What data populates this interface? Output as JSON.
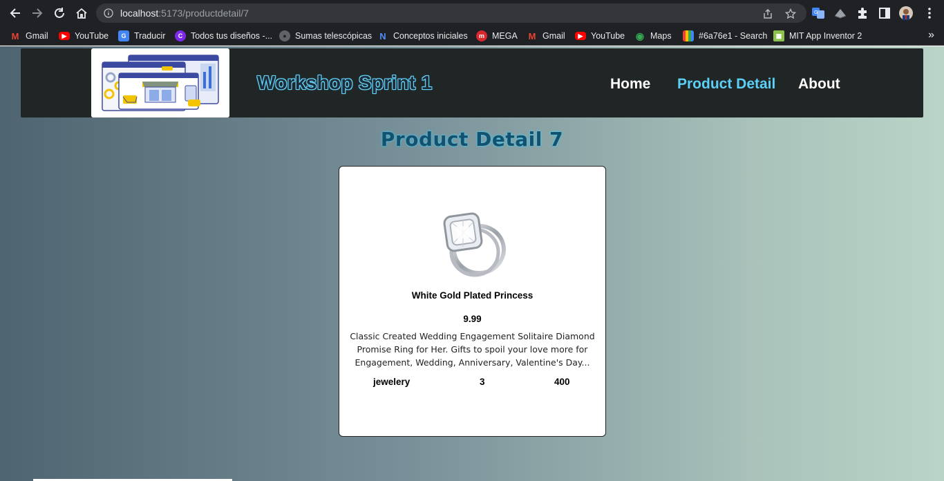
{
  "browser": {
    "url_host": "localhost",
    "url_rest": ":5173/productdetail/7",
    "icons": [
      "back-icon",
      "forward-icon",
      "reload-icon",
      "home-icon",
      "info-icon",
      "share-icon",
      "star-icon",
      "translate-icon",
      "extension-icon",
      "puzzle-icon",
      "sidepanel-icon",
      "profile-avatar",
      "more-icon"
    ]
  },
  "bookmarks": [
    {
      "label": "Gmail",
      "icon": "gmail-icon",
      "color": "#ea4335"
    },
    {
      "label": "YouTube",
      "icon": "youtube-icon",
      "color": "#ff0000"
    },
    {
      "label": "Traducir",
      "icon": "translate-icon",
      "color": "#4285f4"
    },
    {
      "label": "Todos tus diseños -...",
      "icon": "canva-icon",
      "color": "#7d2ae8"
    },
    {
      "label": "Sumas telescópicas",
      "icon": "globe-icon",
      "color": "#9aa0a6"
    },
    {
      "label": "Conceptos iniciales",
      "icon": "notion-icon",
      "color": "#2b6cd4"
    },
    {
      "label": "MEGA",
      "icon": "mega-icon",
      "color": "#d9272e"
    },
    {
      "label": "Gmail",
      "icon": "gmail-icon",
      "color": "#ea4335"
    },
    {
      "label": "YouTube",
      "icon": "youtube-icon",
      "color": "#ff0000"
    },
    {
      "label": "Maps",
      "icon": "maps-icon",
      "color": "#34a853"
    },
    {
      "label": "#6a76e1 - Search",
      "icon": "colorbar-icon",
      "color": "#f4b400"
    },
    {
      "label": "MIT App Inventor 2",
      "icon": "appinventor-icon",
      "color": "#8bc34a"
    }
  ],
  "header": {
    "brand": "Workshop Sprint 1",
    "nav": [
      {
        "label": "Home",
        "active": false
      },
      {
        "label": "Product Detail",
        "active": true
      },
      {
        "label": "About",
        "active": false
      }
    ]
  },
  "main": {
    "title": "Product Detail 7",
    "product": {
      "name": "White Gold Plated Princess",
      "price": "9.99",
      "description": "Classic Created Wedding Engagement Solitaire Diamond Promise Ring for Her. Gifts to spoil your love more for Engagement, Wedding, Anniversary, Valentine's Day...",
      "category": "jewelery",
      "rating": "3",
      "count": "400"
    }
  },
  "colors": {
    "accent": "#5ccff6",
    "header_bg": "#202626",
    "title": "#15506c"
  }
}
